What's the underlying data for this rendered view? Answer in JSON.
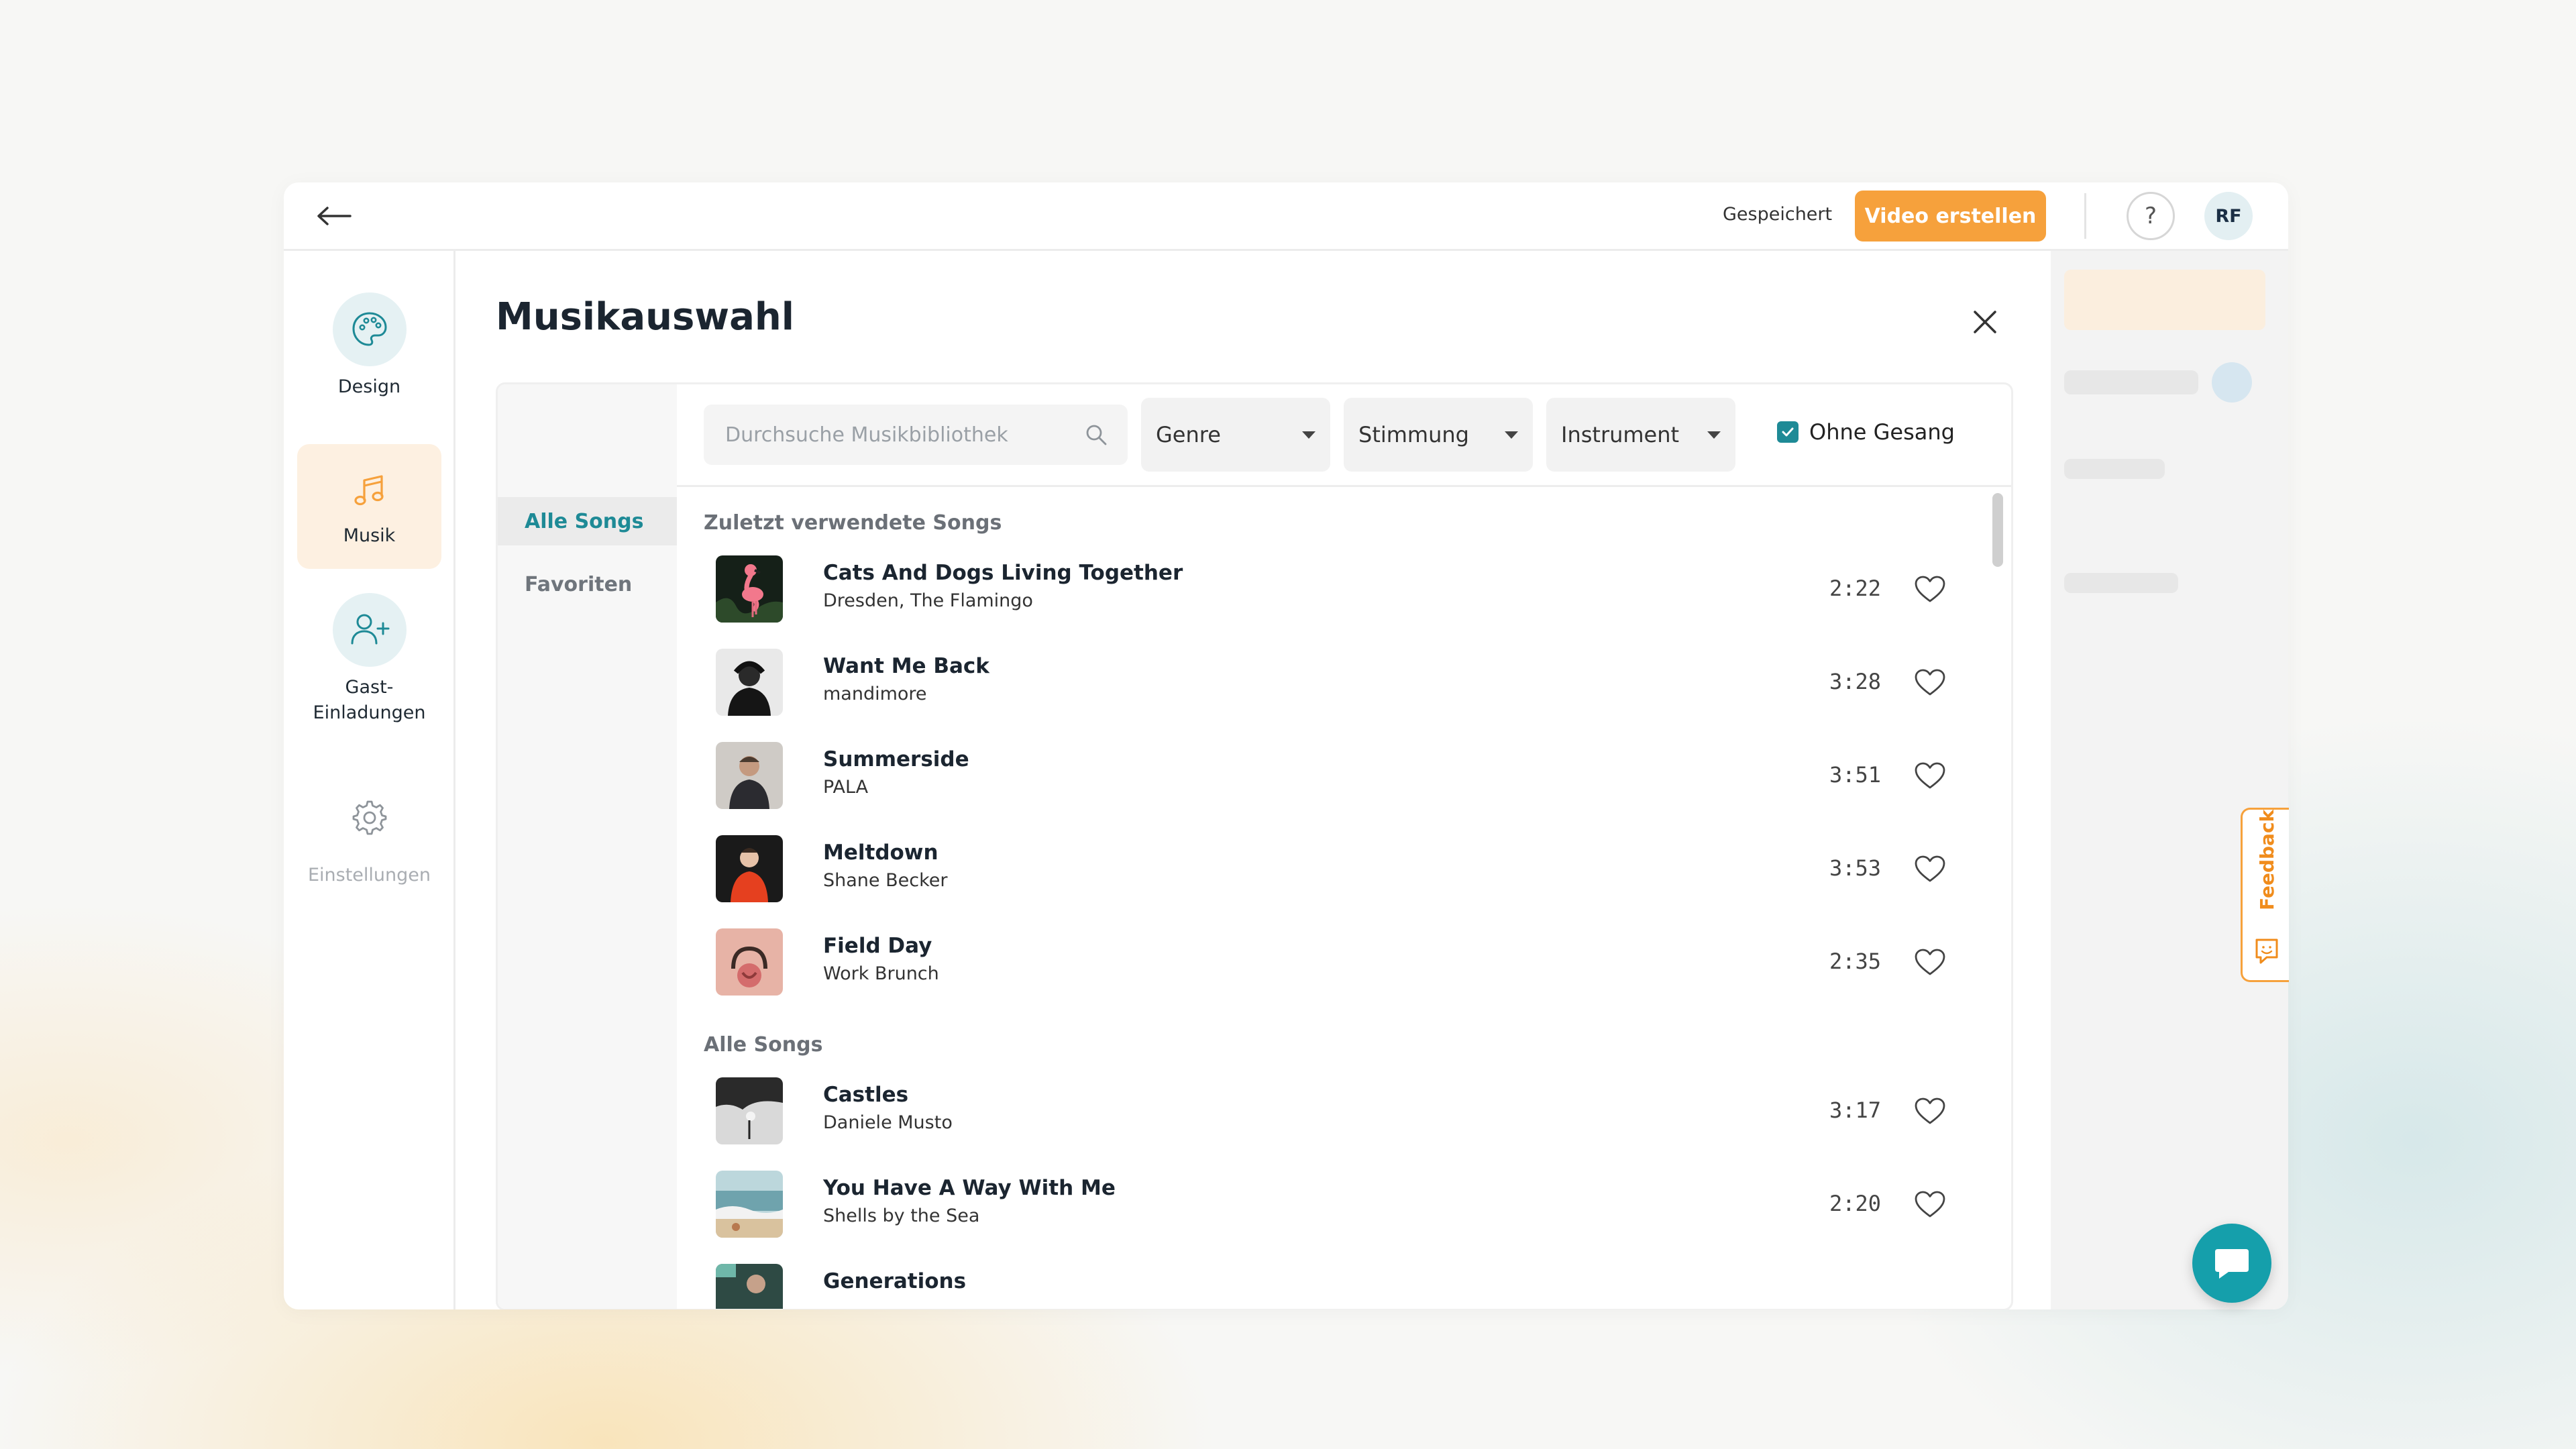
{
  "topbar": {
    "saved_text": "Gespeichert",
    "create_video_label": "Video erstellen",
    "help_label": "?",
    "avatar_initials": "RF"
  },
  "sidebar": {
    "items": [
      {
        "label": "Design",
        "icon": "palette-icon"
      },
      {
        "label": "Musik",
        "icon": "music-note-icon"
      },
      {
        "label": "Gast-\nEinladungen",
        "icon": "add-user-icon"
      },
      {
        "label": "Einstellungen",
        "icon": "gear-icon"
      }
    ]
  },
  "modal": {
    "title": "Musikauswahl",
    "tabs": [
      "Alle Songs",
      "Favoriten"
    ],
    "search_placeholder": "Durchsuche Musikbibliothek",
    "filters": [
      "Genre",
      "Stimmung",
      "Instrument"
    ],
    "checkbox_label": "Ohne Gesang",
    "checkbox_checked": true,
    "recent_heading": "Zuletzt verwendete Songs",
    "all_heading": "Alle Songs",
    "recent_songs": [
      {
        "title": "Cats And Dogs Living Together",
        "artist": "Dresden, The Flamingo",
        "duration": "2:22"
      },
      {
        "title": "Want Me Back",
        "artist": "mandimore",
        "duration": "3:28"
      },
      {
        "title": "Summerside",
        "artist": "PALA",
        "duration": "3:51"
      },
      {
        "title": "Meltdown",
        "artist": "Shane Becker",
        "duration": "3:53"
      },
      {
        "title": "Field Day",
        "artist": "Work Brunch",
        "duration": "2:35"
      }
    ],
    "all_songs": [
      {
        "title": "Castles",
        "artist": "Daniele Musto",
        "duration": "3:17"
      },
      {
        "title": "You Have A Way With Me",
        "artist": "Shells by the Sea",
        "duration": "2:20"
      },
      {
        "title": "Generations",
        "artist": "",
        "duration": ""
      }
    ]
  },
  "feedback": {
    "label": "Feedback"
  },
  "colors": {
    "accent": "#f6a13c",
    "teal": "#1e8a96",
    "chat": "#159fab"
  }
}
